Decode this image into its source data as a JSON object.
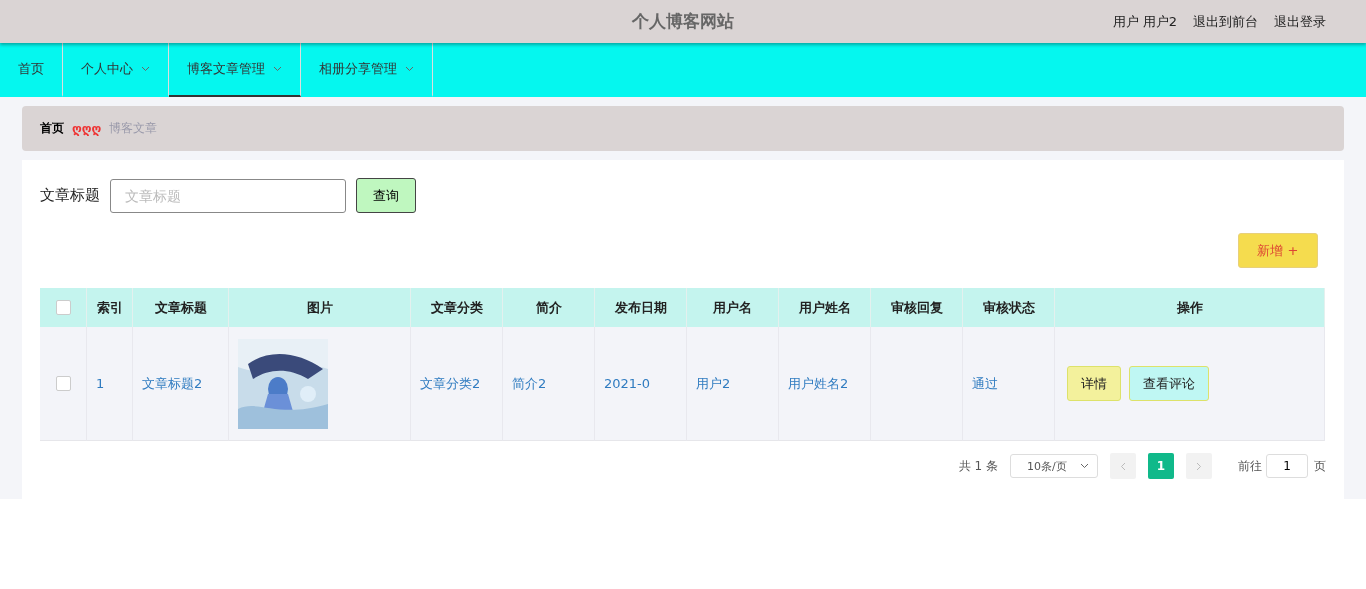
{
  "header": {
    "title": "个人博客网站",
    "user_label": "用户",
    "user_name": "用户2",
    "links": [
      "退出到前台",
      "退出登录"
    ]
  },
  "nav": [
    {
      "label": "首页",
      "selected": false,
      "dropdown": false
    },
    {
      "label": "个人中心",
      "selected": false,
      "dropdown": true
    },
    {
      "label": "博客文章管理",
      "selected": true,
      "dropdown": true
    },
    {
      "label": "相册分享管理",
      "selected": false,
      "dropdown": true
    }
  ],
  "breadcrumb": {
    "home": "首页",
    "separator": "ღღღ",
    "current": "博客文章"
  },
  "search": {
    "label": "文章标题",
    "placeholder": "文章标题",
    "button": "查询"
  },
  "add_button": "新增 +",
  "table": {
    "all_checked": false,
    "columns": [
      "索引",
      "文章标题",
      "图片",
      "文章分类",
      "简介",
      "发布日期",
      "用户名",
      "用户姓名",
      "审核回复",
      "审核状态",
      "操作"
    ],
    "rows": [
      {
        "checked": false,
        "cells": [
          "1",
          "文章标题2",
          {
            "kind": "picture"
          },
          "文章分类2",
          "简介2",
          "2021-0",
          "用户2",
          "用户姓名2",
          "",
          "通过"
        ],
        "actions": [
          "详情",
          "查看评论"
        ]
      }
    ]
  },
  "pagination": {
    "total": "共 1 条",
    "page_size": "10条/页",
    "pages": [
      {
        "label": "1",
        "selected": true
      }
    ],
    "goto_label": "前往",
    "goto_value": "1",
    "goto_suffix": "页"
  }
}
